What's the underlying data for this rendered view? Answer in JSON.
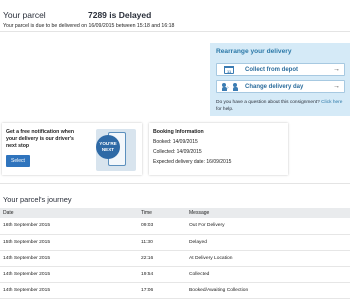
{
  "header": {
    "title": "Your parcel",
    "status": "7289 is Delayed",
    "subtitle": "Your parcel is due to be delivered on 16/09/2015 between 15:18 and 16:18"
  },
  "rearrange": {
    "title": "Rearrange your delivery",
    "collect_label": "Collect from depot",
    "change_label": "Change delivery day",
    "calendar_icon_text": "11",
    "arrow": "→",
    "help_text": "Do you have a question about this consignment?",
    "help_link": "Click here",
    "help_suffix": "for help."
  },
  "notify": {
    "text": "Get a free notification when your delivery is our driver's next stop",
    "button": "Select",
    "badge": "YOU'RE NEXT"
  },
  "booking": {
    "title": "Booking Information",
    "booked": "Booked: 14/09/2015",
    "collected": "Collected: 14/09/2015",
    "expected": "Expected delivery date: 16/09/2015"
  },
  "journey": {
    "title": "Your parcel's journey",
    "columns": [
      "Date",
      "Time",
      "Message"
    ],
    "rows": [
      {
        "date": "16th September 2015",
        "time": "09:03",
        "message": "Out For Delivery"
      },
      {
        "date": "15th September 2015",
        "time": "11:30",
        "message": "Delayed"
      },
      {
        "date": "14th September 2015",
        "time": "22:16",
        "message": "At Delivery Location"
      },
      {
        "date": "14th September 2015",
        "time": "19:54",
        "message": "Collected"
      },
      {
        "date": "14th September 2015",
        "time": "17:06",
        "message": "Booked/Awaiting Collection"
      }
    ]
  }
}
